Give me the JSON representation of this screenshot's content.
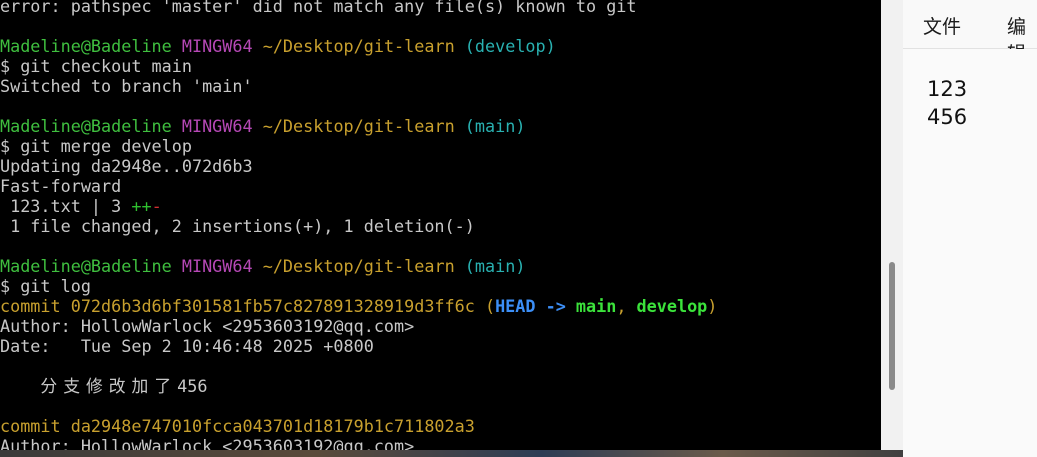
{
  "terminal": {
    "lines": [
      {
        "segs": [
          {
            "t": "error: pathspec 'master' did not match any file(s) known to git"
          }
        ]
      },
      {
        "segs": []
      },
      {
        "segs": [
          {
            "t": "Madeline@Badeline",
            "c": "g"
          },
          {
            "t": " "
          },
          {
            "t": "MINGW64",
            "c": "m"
          },
          {
            "t": " "
          },
          {
            "t": "~/Desktop/git-learn",
            "c": "y"
          },
          {
            "t": " "
          },
          {
            "t": "(develop)",
            "c": "c"
          }
        ]
      },
      {
        "segs": [
          {
            "t": "$ git checkout main"
          }
        ]
      },
      {
        "segs": [
          {
            "t": "Switched to branch 'main'"
          }
        ]
      },
      {
        "segs": []
      },
      {
        "segs": [
          {
            "t": "Madeline@Badeline",
            "c": "g"
          },
          {
            "t": " "
          },
          {
            "t": "MINGW64",
            "c": "m"
          },
          {
            "t": " "
          },
          {
            "t": "~/Desktop/git-learn",
            "c": "y"
          },
          {
            "t": " "
          },
          {
            "t": "(main)",
            "c": "c"
          }
        ]
      },
      {
        "segs": [
          {
            "t": "$ git merge develop"
          }
        ]
      },
      {
        "segs": [
          {
            "t": "Updating da2948e..072d6b3"
          }
        ]
      },
      {
        "segs": [
          {
            "t": "Fast-forward"
          }
        ]
      },
      {
        "segs": [
          {
            "t": " 123.txt | 3 "
          },
          {
            "t": "++",
            "c": "plus"
          },
          {
            "t": "-",
            "c": "minus"
          }
        ]
      },
      {
        "segs": [
          {
            "t": " 1 file changed, 2 insertions(+), 1 deletion(-)"
          }
        ]
      },
      {
        "segs": []
      },
      {
        "segs": [
          {
            "t": "Madeline@Badeline",
            "c": "g"
          },
          {
            "t": " "
          },
          {
            "t": "MINGW64",
            "c": "m"
          },
          {
            "t": " "
          },
          {
            "t": "~/Desktop/git-learn",
            "c": "y"
          },
          {
            "t": " "
          },
          {
            "t": "(main)",
            "c": "c"
          }
        ]
      },
      {
        "segs": [
          {
            "t": "$ git log"
          }
        ]
      },
      {
        "segs": [
          {
            "t": "commit 072d6b3d6bf301581fb57c827891328919d3ff6c",
            "c": "cmt"
          },
          {
            "t": " (",
            "c": "cmt"
          },
          {
            "t": "HEAD -> ",
            "c": "hd"
          },
          {
            "t": "main",
            "c": "br"
          },
          {
            "t": ", ",
            "c": "cmt"
          },
          {
            "t": "develop",
            "c": "br"
          },
          {
            "t": ")",
            "c": "cmt"
          }
        ]
      },
      {
        "segs": [
          {
            "t": "Author: HollowWarlock <2953603192@qq.com>"
          }
        ]
      },
      {
        "segs": [
          {
            "t": "Date:   Tue Sep 2 10:46:48 2025 +0800"
          }
        ]
      },
      {
        "segs": []
      },
      {
        "segs": [
          {
            "t": "    "
          },
          {
            "t": "分支修改加了",
            "c": "cn"
          },
          {
            "t": "456"
          }
        ]
      },
      {
        "segs": []
      },
      {
        "segs": [
          {
            "t": "commit da2948e747010fcca043701d18179b1c711802a3",
            "c": "cmt"
          }
        ]
      },
      {
        "segs": [
          {
            "t": "Author: HollowWarlock <2953603192@qq.com>"
          }
        ]
      }
    ]
  },
  "notepad": {
    "menu": [
      "文件",
      "编辑"
    ],
    "content": [
      "123",
      "456"
    ]
  }
}
